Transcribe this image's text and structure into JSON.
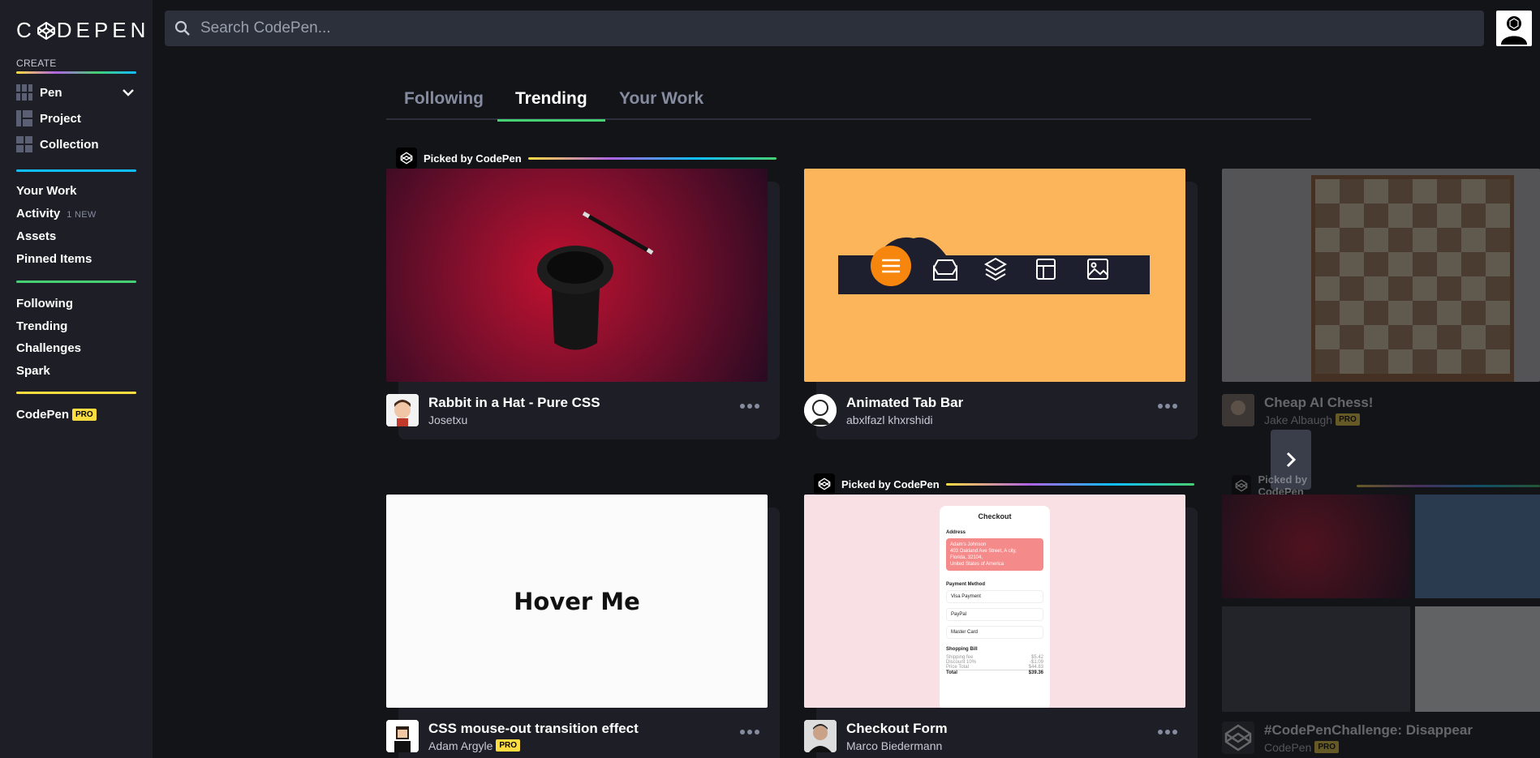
{
  "brand": {
    "logo_text_1": "C",
    "logo_text_2": "DEPEN"
  },
  "sidebar": {
    "create_label": "CREATE",
    "create_items": [
      {
        "label": "Pen"
      },
      {
        "label": "Project"
      },
      {
        "label": "Collection"
      }
    ],
    "nav_group_1": [
      {
        "label": "Your Work"
      },
      {
        "label": "Activity",
        "badge": "1 NEW"
      },
      {
        "label": "Assets"
      },
      {
        "label": "Pinned Items"
      }
    ],
    "nav_group_2": [
      {
        "label": "Following"
      },
      {
        "label": "Trending"
      },
      {
        "label": "Challenges"
      },
      {
        "label": "Spark"
      }
    ],
    "codepen_pro": {
      "label": "CodePen",
      "badge": "PRO"
    }
  },
  "search": {
    "placeholder": "Search CodePen..."
  },
  "tabs": [
    {
      "label": "Following"
    },
    {
      "label": "Trending",
      "active": true
    },
    {
      "label": "Your Work"
    }
  ],
  "picked_label": "Picked by CodePen",
  "pro_badge": "PRO",
  "cards": [
    {
      "title": "Rabbit in a Hat - Pure CSS",
      "author": "Josetxu",
      "picked": true
    },
    {
      "title": "Animated Tab Bar",
      "author": "abxlfazl khxrshidi",
      "picked": false
    },
    {
      "title": "Cheap AI Chess!",
      "author": "Jake Albaugh",
      "pro": true,
      "picked": false
    },
    {
      "title": "CSS mouse-out transition effect",
      "author": "Adam Argyle",
      "pro": true,
      "picked": false,
      "thumb_text": "Hover Me"
    },
    {
      "title": "Checkout Form",
      "author": "Marco Biedermann",
      "picked": true
    },
    {
      "title": "#CodePenChallenge: Disappear",
      "author": "CodePen",
      "pro": true,
      "picked": true
    }
  ],
  "checkout": {
    "heading": "Checkout",
    "address_label": "Address",
    "address_lines": [
      "Adam's Johnson",
      "403 Oakland Ave Street, A city,",
      "Florida, 32104,",
      "United States of America"
    ],
    "payment_label": "Payment Method",
    "payment_options": [
      "Visa Payment",
      "PayPal",
      "Master Card"
    ],
    "bill_label": "Shopping Bill",
    "bill_rows": [
      {
        "label": "Shipping fee",
        "value": "$5.42"
      },
      {
        "label": "Discount 10%",
        "value": "-$1.09"
      },
      {
        "label": "Price Total",
        "value": "$44.83"
      },
      {
        "label": "Total",
        "value": "$39.36"
      }
    ]
  },
  "colors": {
    "accent_green": "#47cf73",
    "pro_yellow": "#ffdd40",
    "sidebar_bg": "#1e1f26",
    "page_bg": "#131417"
  }
}
